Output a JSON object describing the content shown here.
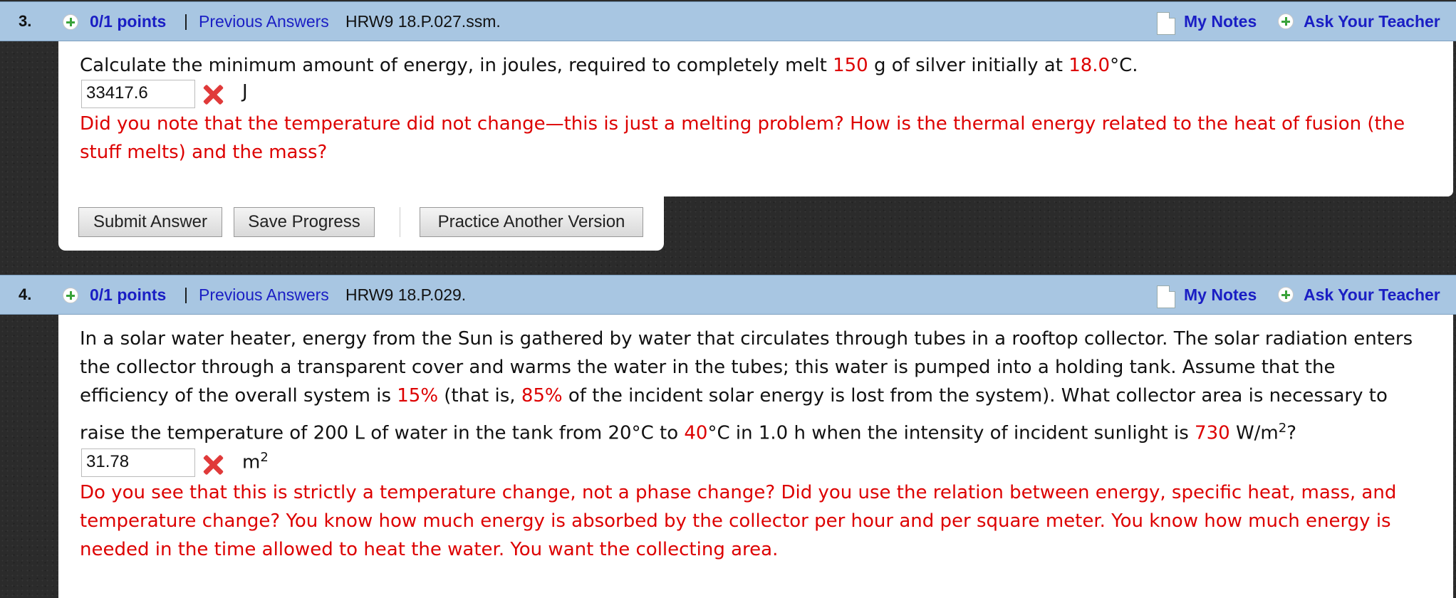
{
  "questions": [
    {
      "number": "3.",
      "points": "0/1 points",
      "separator": "|",
      "previous_answers": "Previous Answers",
      "code": "HRW9 18.P.027.ssm.",
      "my_notes": "My Notes",
      "ask_teacher": "Ask Your Teacher",
      "question_parts": [
        "Calculate the minimum amount of energy, in joules, required to completely melt ",
        "150",
        " g of silver initially at ",
        "18.0",
        "°C."
      ],
      "answer_value": "33417.6",
      "unit": "J",
      "feedback_lines": [
        "Did you note that the temperature did not change—this is just a melting problem? How is the thermal energy related to the heat of fusion (the",
        "stuff melts) and the mass?"
      ],
      "buttons": {
        "submit": "Submit Answer",
        "save": "Save Progress",
        "practice": "Practice Another Version"
      }
    },
    {
      "number": "4.",
      "points": "0/1 points",
      "separator": "|",
      "previous_answers": "Previous Answers",
      "code": "HRW9 18.P.029.",
      "my_notes": "My Notes",
      "ask_teacher": "Ask Your Teacher",
      "question_lines": [
        "In a solar water heater, energy from the Sun is gathered by water that circulates through tubes in a rooftop collector. The solar radiation enters",
        "the collector through a transparent cover and warms the water in the tubes; this water is pumped into a holding tank. Assume that the"
      ],
      "line3_parts": [
        "efficiency of the overall system is ",
        "15%",
        " (that is, ",
        "85%",
        " of the incident solar energy is lost from the system). What collector area is necessary to"
      ],
      "line4_parts": [
        "raise the temperature of 200 L of water in the tank from 20°C to ",
        "40",
        "°C in 1.0 h when the intensity of incident sunlight is ",
        "730",
        " W/m",
        "2",
        "?"
      ],
      "answer_value": "31.78",
      "unit": "m",
      "unit_sup": "2",
      "feedback_lines": [
        "Do you see that this is strictly a temperature change, not a phase change? Did you use the relation between energy, specific heat, mass, and",
        "temperature change? You know how much energy is absorbed by the collector per hour and per square meter. You know how much energy is",
        "needed in the time allowed to heat the water. You want the collecting area."
      ]
    }
  ]
}
